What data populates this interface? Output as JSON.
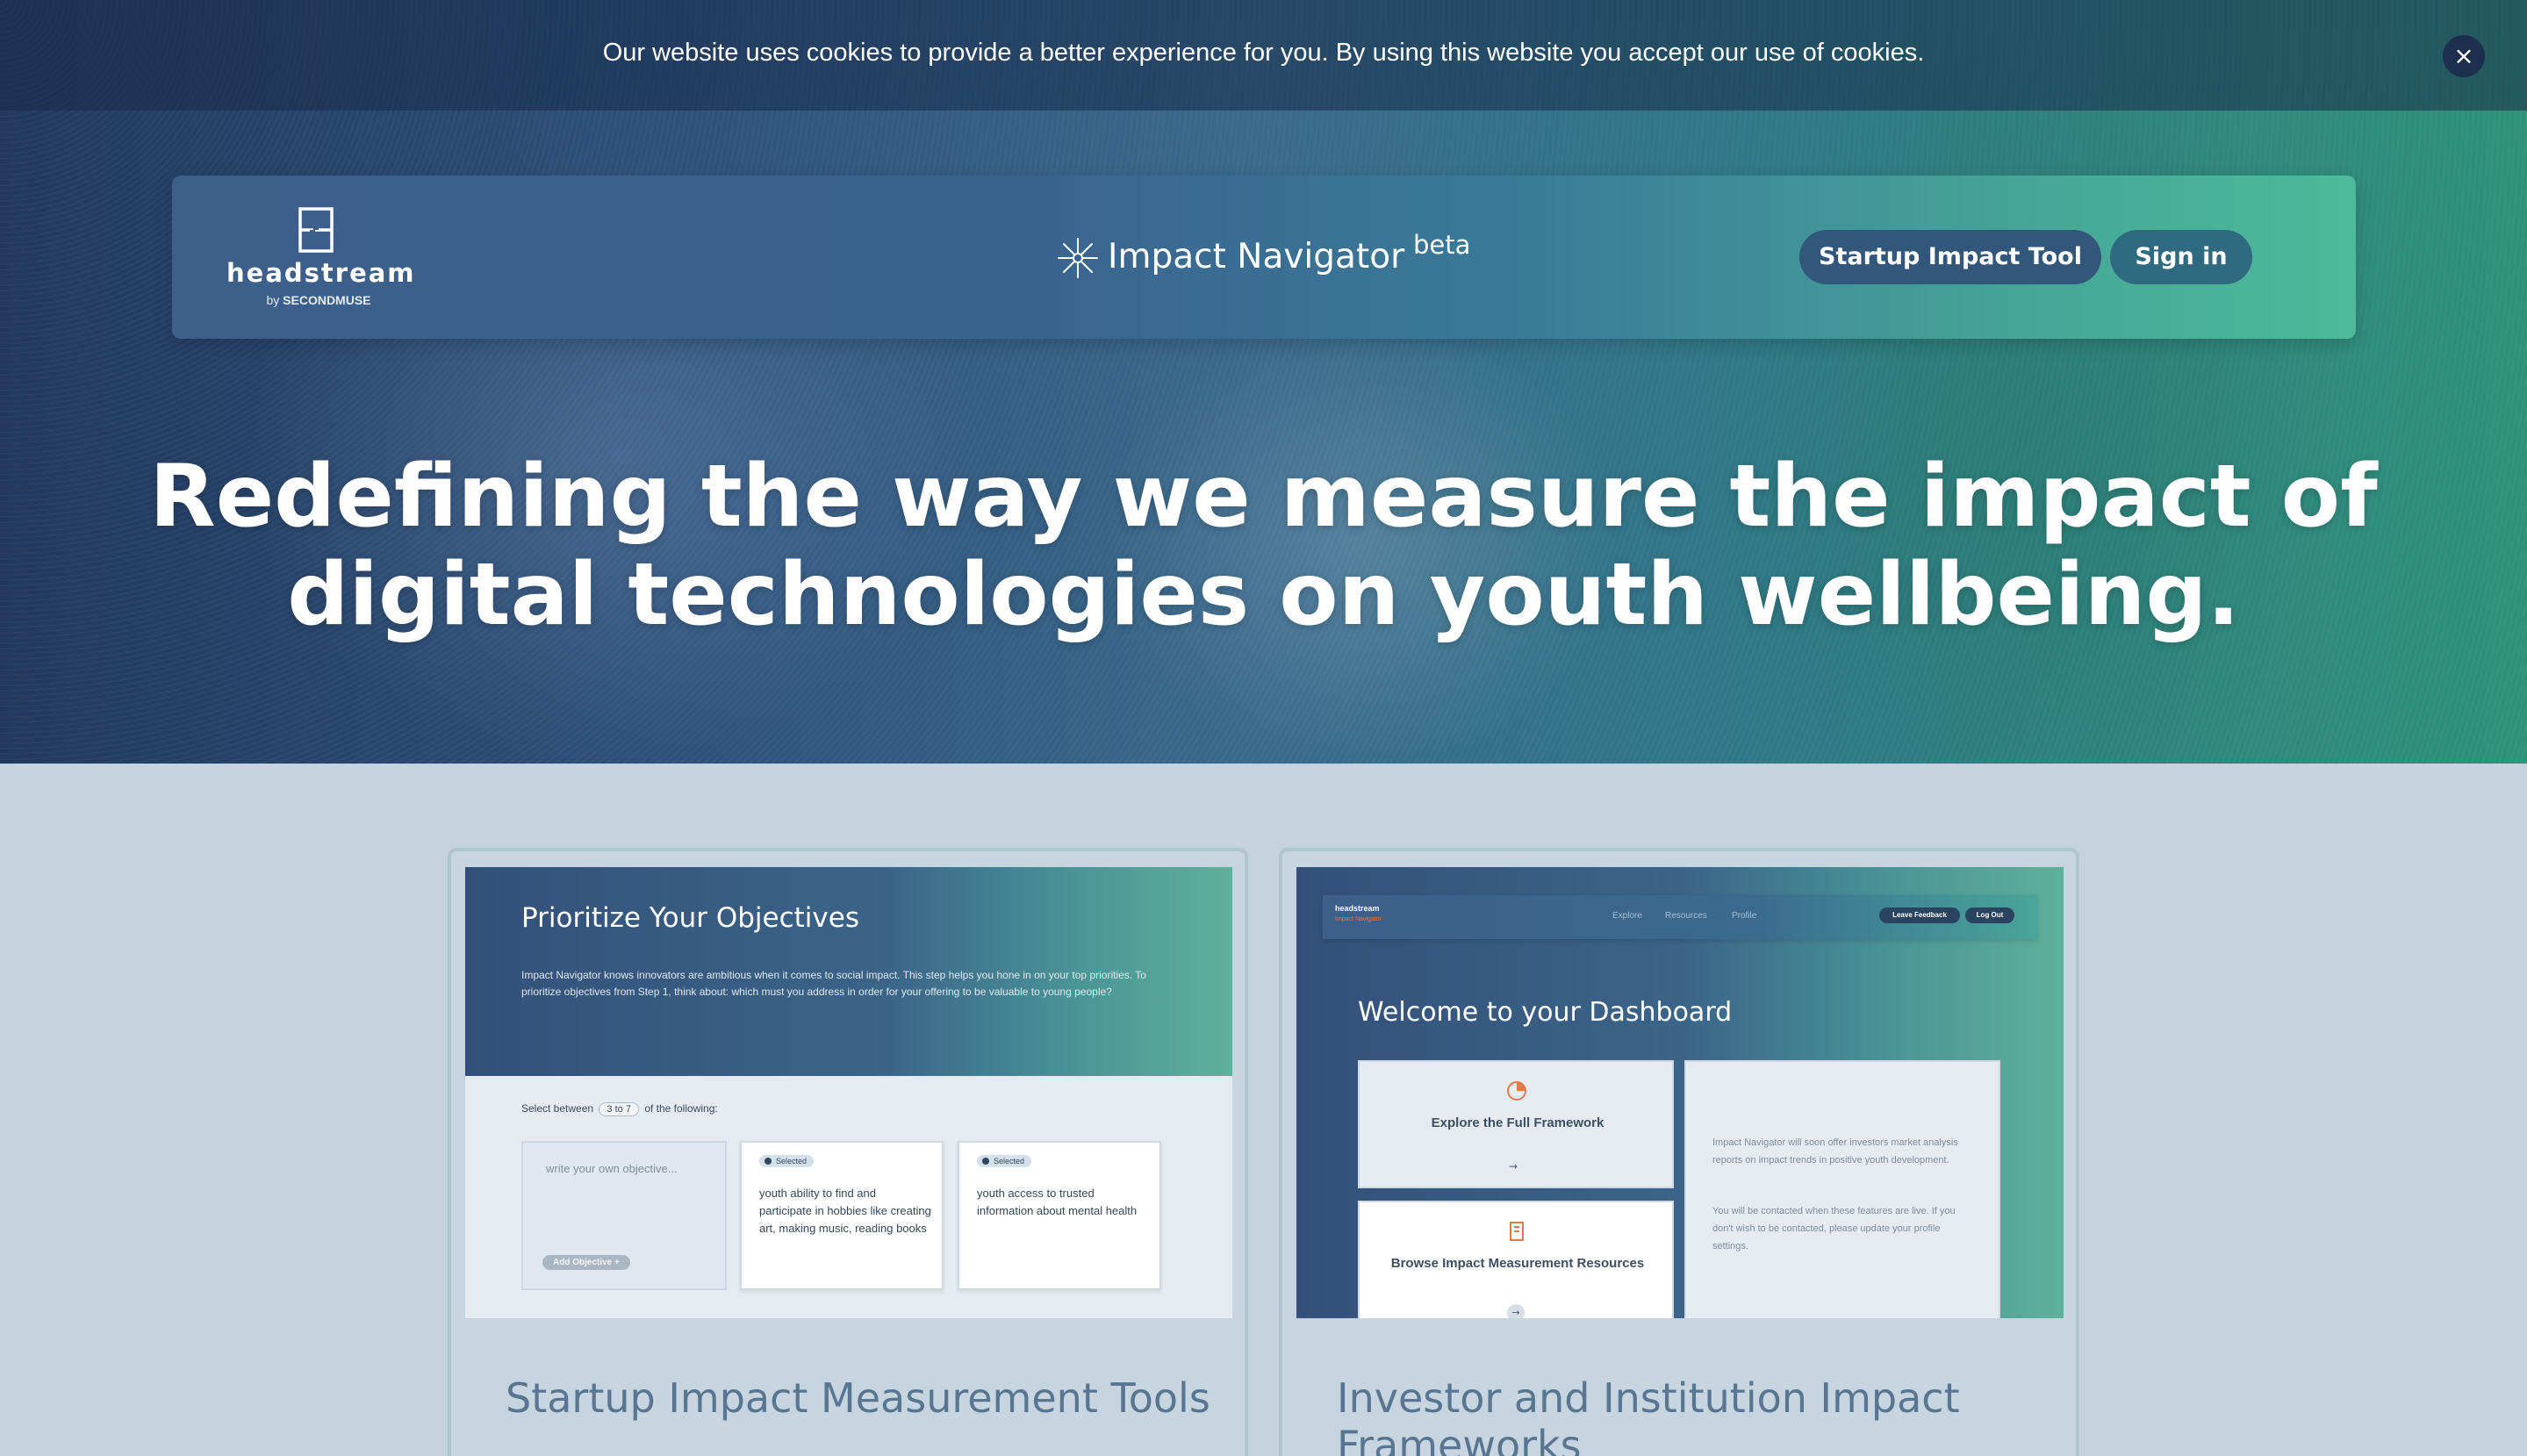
{
  "cookie_banner": {
    "text": "Our website uses cookies to provide a better experience for you. By using this website you accept our use of cookies.",
    "close_label": "×"
  },
  "header": {
    "logo_text": "headstream",
    "logo_by": "by",
    "logo_by_brand": "SECONDMUSE",
    "product_name": "Impact Navigator",
    "product_tag": "beta",
    "startup_button": "Startup Impact Tool",
    "signin_button": "Sign in"
  },
  "hero": {
    "headline_line1": "Redefining the way we measure the impact of",
    "headline_line2": "digital technologies on youth wellbeing."
  },
  "cards": [
    {
      "title": "Startup Impact Measurement Tools",
      "preview": {
        "heading": "Prioritize Your Objectives",
        "paragraph": "Impact Navigator knows innovators are ambitious when it comes to social impact. This step helps you hone in on your top priorities. To prioritize objectives from Step 1, think about: which must you address in order for your offering to be valuable to young people?",
        "select_prefix": "Select between",
        "range_from": "3",
        "range_word": "to",
        "range_to": "7",
        "select_suffix": "of the following:",
        "input_placeholder": "write your own objective...",
        "add_button": "Add Objective +",
        "objectives": [
          {
            "badge": "Selected",
            "text": "youth ability to find and participate in hobbies like creating art, making music, reading books"
          },
          {
            "badge": "Selected",
            "text": "youth access to trusted information about mental health"
          }
        ]
      }
    },
    {
      "title": "Investor and Institution Impact Frameworks",
      "preview": {
        "logo": "headstream",
        "logo_sub": "Impact Navigator",
        "nav_links": [
          "Explore",
          "Resources",
          "Profile"
        ],
        "feedback_button": "Leave Feedback",
        "logout_button": "Log Out",
        "heading": "Welcome to your Dashboard",
        "tile1_title": "Explore the Full Framework",
        "tile2_title": "Browse Impact Measurement Resources",
        "info_para1": "Impact Navigator will soon offer investors market analysis reports on impact trends in positive youth development.",
        "info_para2": "You will be contacted when these features are live. If you don't wish to be contacted, please update your profile settings."
      }
    }
  ],
  "colors": {
    "nav_button": "#33577b",
    "card_title": "#587591",
    "page_bg": "#c4d3de"
  }
}
